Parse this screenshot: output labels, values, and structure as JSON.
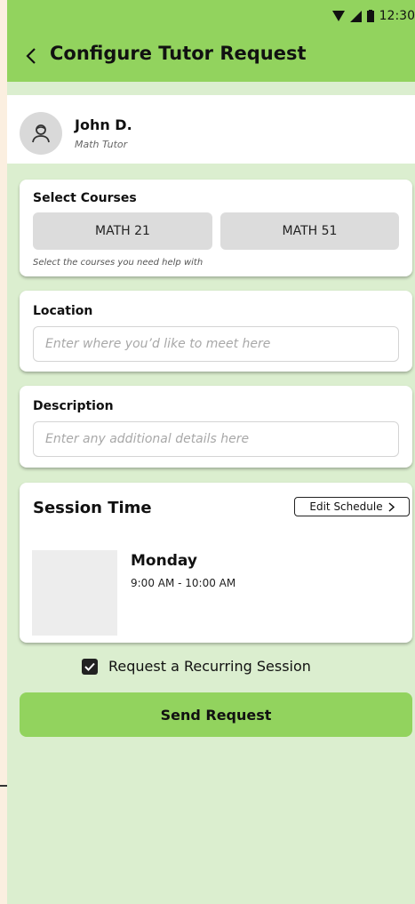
{
  "status_bar": {
    "time": "12:30"
  },
  "header": {
    "title": "Configure Tutor Request"
  },
  "tutor": {
    "name": "John D.",
    "role": "Math Tutor"
  },
  "courses": {
    "label": "Select Courses",
    "options": [
      "MATH 21",
      "MATH 51"
    ],
    "hint": "Select the courses you need help with"
  },
  "location": {
    "label": "Location",
    "value": "",
    "placeholder": "Enter where you’d like to meet here"
  },
  "description": {
    "label": "Description",
    "value": "",
    "placeholder": "Enter any additional details here"
  },
  "session": {
    "title": "Session Time",
    "edit_label": "Edit Schedule",
    "day": "Monday",
    "time_range": "9:00 AM - 10:00 AM"
  },
  "recurring": {
    "label": "Request a Recurring Session",
    "checked": true
  },
  "submit": {
    "label": "Send Request"
  },
  "colors": {
    "accent": "#92d35e",
    "background": "#dbeecf"
  }
}
